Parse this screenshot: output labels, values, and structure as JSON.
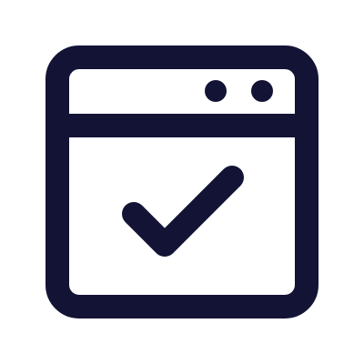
{
  "icon": {
    "name": "browser-window-check-icon",
    "stroke_color": "#131336",
    "background_color": "#ffffff",
    "parts": {
      "window_frame": "window-frame-icon",
      "title_bar": "title-bar-icon",
      "dot_1": "window-dot-icon",
      "dot_2": "window-dot-icon",
      "check": "checkmark-icon"
    }
  }
}
